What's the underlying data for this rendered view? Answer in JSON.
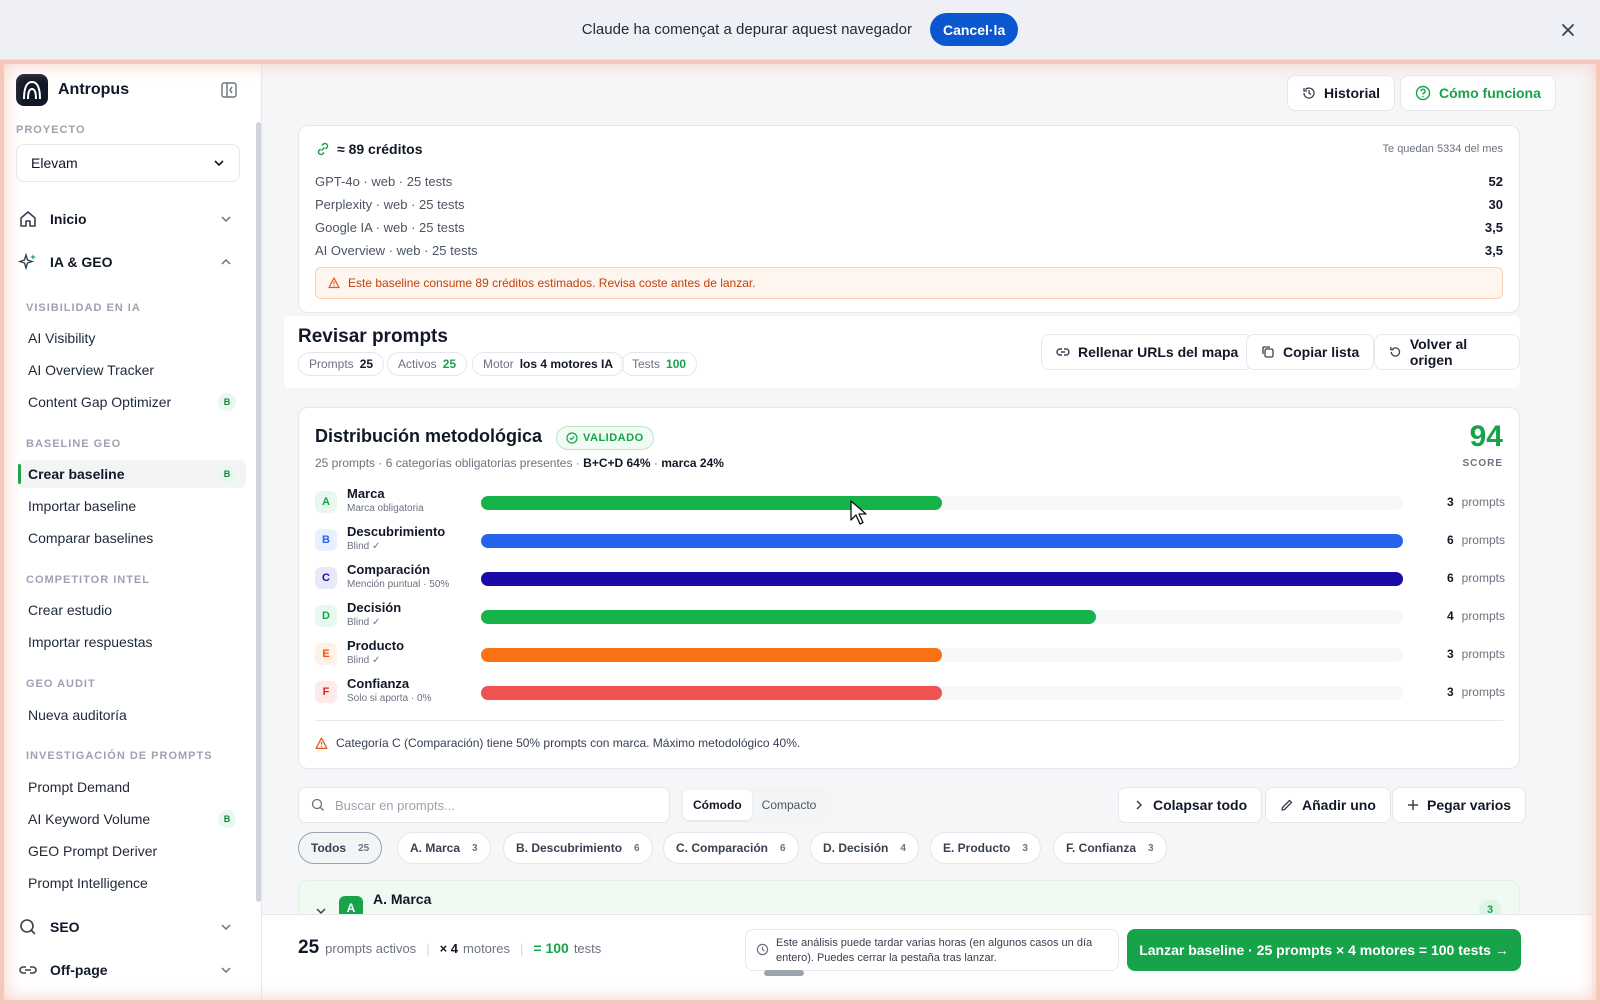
{
  "browser_bar": {
    "message": "Claude ha començat a depurar aquest navegador",
    "cancel_label": "Cancel·la"
  },
  "sidebar": {
    "brand": "Antropus",
    "project_label": "PROYECTO",
    "project_value": "Elevam",
    "top_nav": [
      {
        "label": "Inicio",
        "icon": "home-icon"
      },
      {
        "label": "IA & GEO",
        "icon": "sparkle-icon"
      }
    ],
    "sections": [
      {
        "title": "VISIBILIDAD EN IA",
        "items": [
          {
            "label": "AI Visibility"
          },
          {
            "label": "AI Overview Tracker"
          },
          {
            "label": "Content Gap Optimizer",
            "badge": "B"
          }
        ]
      },
      {
        "title": "BASELINE GEO",
        "items": [
          {
            "label": "Crear baseline",
            "badge": "B",
            "active": true
          },
          {
            "label": "Importar baseline"
          },
          {
            "label": "Comparar baselines"
          }
        ]
      },
      {
        "title": "COMPETITOR INTEL",
        "items": [
          {
            "label": "Crear estudio"
          },
          {
            "label": "Importar respuestas"
          }
        ]
      },
      {
        "title": "GEO AUDIT",
        "items": [
          {
            "label": "Nueva auditoría"
          }
        ]
      },
      {
        "title": "INVESTIGACIÓN DE PROMPTS",
        "items": [
          {
            "label": "Prompt Demand"
          },
          {
            "label": "AI Keyword Volume",
            "badge": "B"
          },
          {
            "label": "GEO Prompt Deriver"
          },
          {
            "label": "Prompt Intelligence"
          }
        ]
      }
    ],
    "bottom_nav": [
      {
        "label": "SEO",
        "icon": "search-icon"
      },
      {
        "label": "Off-page",
        "icon": "link-icon"
      }
    ]
  },
  "header": {
    "history_label": "Historial",
    "how_label": "Cómo funciona"
  },
  "credits": {
    "title": "≈ 89 créditos",
    "remaining": "Te quedan 5334 del mes",
    "rows": [
      {
        "label": "GPT-4o · web · 25 tests",
        "value": "52"
      },
      {
        "label": "Perplexity · web · 25 tests",
        "value": "30"
      },
      {
        "label": "Google IA · web · 25 tests",
        "value": "3,5"
      },
      {
        "label": "AI Overview · web · 25 tests",
        "value": "3,5"
      }
    ],
    "warning": "Este baseline consume 89 créditos estimados. Revisa coste antes de lanzar."
  },
  "review": {
    "title": "Revisar prompts",
    "chips": [
      {
        "label": "Prompts",
        "value": "25"
      },
      {
        "label": "Activos",
        "value": "25"
      },
      {
        "label": "Motor",
        "value": "los 4 motores IA"
      },
      {
        "label": "Tests",
        "value": "100"
      }
    ],
    "actions": [
      "Rellenar URLs del mapa",
      "Copiar lista",
      "Volver al origen"
    ]
  },
  "distribution": {
    "title": "Distribución metodológica",
    "status": "VALIDADO",
    "summary": "25 prompts · 6 categorías obligatorias presentes ·",
    "summary_bold_1": "B+C+D 64%",
    "summary_sep": "·",
    "summary_bold_2": "marca 24%",
    "score": "94",
    "score_label": "SCORE",
    "unit": "prompts",
    "categories": [
      {
        "letter": "A",
        "name": "Marca",
        "sub": "Marca obligatoria",
        "count": 3,
        "share": 0.5,
        "color": "#16b34a",
        "bg": "#e8f8ee",
        "fg": "#16a34a"
      },
      {
        "letter": "B",
        "name": "Descubrimiento",
        "sub": "Blind ✓",
        "count": 6,
        "share": 1.0,
        "color": "#2563eb",
        "bg": "#e8efff",
        "fg": "#2563eb"
      },
      {
        "letter": "C",
        "name": "Comparación",
        "sub": "Mención puntual · 50%",
        "count": 6,
        "share": 1.0,
        "color": "#1a0aa8",
        "bg": "#e9e8fb",
        "fg": "#1a0aa8"
      },
      {
        "letter": "D",
        "name": "Decisión",
        "sub": "Blind ✓",
        "count": 4,
        "share": 0.6667,
        "color": "#16b34a",
        "bg": "#e8f8ee",
        "fg": "#16a34a"
      },
      {
        "letter": "E",
        "name": "Producto",
        "sub": "Blind ✓",
        "count": 3,
        "share": 0.5,
        "color": "#f97316",
        "bg": "#fff1e6",
        "fg": "#ea580c"
      },
      {
        "letter": "F",
        "name": "Confianza",
        "sub": "Solo si aporta · 0%",
        "count": 3,
        "share": 0.5,
        "color": "#f05252",
        "bg": "#fdeaea",
        "fg": "#dc2626"
      }
    ],
    "warning": "Categoría C (Comparación) tiene 50% prompts con marca. Máximo metodológico 40%."
  },
  "toolbar": {
    "search_placeholder": "Buscar en prompts...",
    "view_options": [
      "Cómodo",
      "Compacto"
    ],
    "actions": [
      "Colapsar todo",
      "Añadir uno",
      "Pegar varios"
    ],
    "filters": [
      {
        "label": "Todos",
        "count": "25"
      },
      {
        "label": "A. Marca",
        "count": "3"
      },
      {
        "label": "B. Descubrimiento",
        "count": "6"
      },
      {
        "label": "C. Comparación",
        "count": "6"
      },
      {
        "label": "D. Decisión",
        "count": "4"
      },
      {
        "label": "E. Producto",
        "count": "3"
      },
      {
        "label": "F. Confianza",
        "count": "3"
      }
    ]
  },
  "group": {
    "letter": "A",
    "title": "A. Marca",
    "count": "3"
  },
  "footer": {
    "prompts": "25",
    "prompts_label": "prompts activos",
    "motors_prefix": "× 4",
    "motors_label": "motores",
    "tests_prefix": "= 100",
    "tests_label": "tests",
    "note": "Este análisis puede tardar varias horas (en algunos casos un día entero). Puedes cerrar la pestaña tras lanzar.",
    "launch_label": "Lanzar baseline · 25 prompts × 4 motores = 100 tests →"
  }
}
